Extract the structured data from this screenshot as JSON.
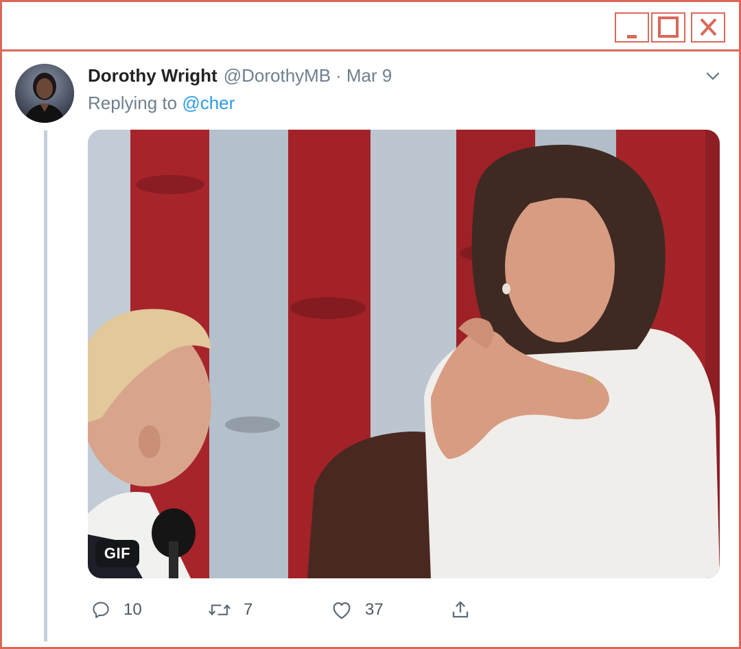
{
  "window": {
    "controls": {
      "minimize_icon": "minimize-icon",
      "maximize_icon": "maximize-icon",
      "close_icon": "close-icon"
    },
    "accent_color": "#d9685a"
  },
  "tweet": {
    "author_name": "Dorothy Wright",
    "author_handle": "@DorothyMB",
    "separator": "·",
    "date": "Mar 9",
    "replying_prefix": "Replying to",
    "replying_to": "@cher",
    "media_badge": "GIF",
    "actions": {
      "reply_count": "10",
      "retweet_count": "7",
      "like_count": "37"
    },
    "icons": [
      "chevron-down-icon",
      "reply-icon",
      "retweet-icon",
      "heart-icon",
      "share-icon"
    ]
  },
  "colors": {
    "link": "#2b9be8",
    "secondary_text": "#6e7f8d",
    "thread_line": "#c4d1dc"
  }
}
